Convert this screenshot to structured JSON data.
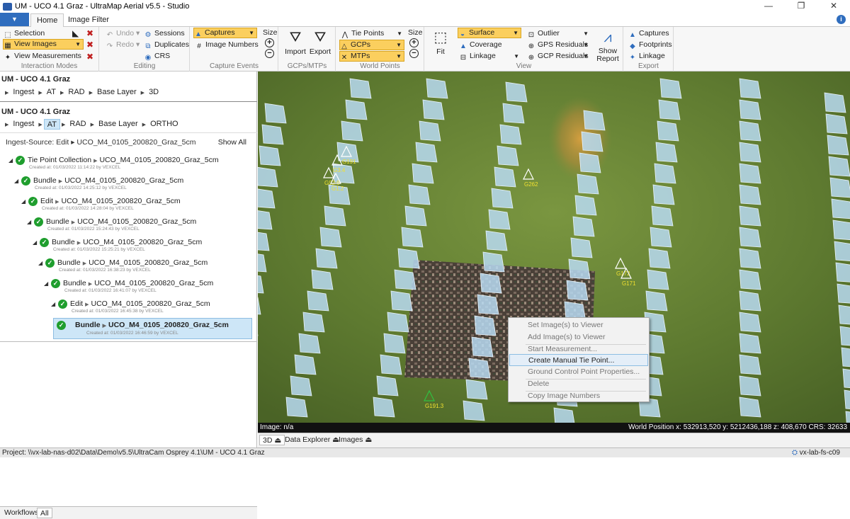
{
  "window": {
    "title": "UM - UCO 4.1 Graz - UltraMap Aerial v5.5 - Studio",
    "controls": [
      "—",
      "❐",
      "✕"
    ]
  },
  "ribbon_tabs": [
    "Home",
    "Image Filter"
  ],
  "ribbon": {
    "interaction": {
      "label": "Interaction Modes",
      "selection": "Selection",
      "view_images": "View Images",
      "view_measurements": "View Measurements"
    },
    "editing": {
      "label": "Editing",
      "undo": "Undo",
      "redo": "Redo",
      "sessions": "Sessions",
      "duplicates": "Duplicates",
      "crs": "CRS"
    },
    "capture": {
      "label": "Capture Events",
      "captures": "Captures",
      "image_numbers": "Image Numbers",
      "size": "Size"
    },
    "gcps": {
      "label": "GCPs/MTPs",
      "import": "Import",
      "export": "Export"
    },
    "world": {
      "label": "World Points",
      "tie_points": "Tie Points",
      "gcps": "GCPs",
      "mtps": "MTPs",
      "size": "Size"
    },
    "view": {
      "label": "View",
      "fit": "Fit",
      "surface": "Surface",
      "coverage": "Coverage",
      "linkage": "Linkage",
      "outlier": "Outlier",
      "gps_residuals": "GPS Residuals",
      "gcp_residuals": "GCP Residuals",
      "show_report_1": "Show",
      "show_report_2": "Report"
    },
    "export": {
      "label": "Export",
      "captures": "Captures",
      "footprints": "Footprints",
      "linkage": "Linkage"
    }
  },
  "workflow_3d": {
    "project": "UM - UCO 4.1 Graz",
    "steps": [
      "Ingest",
      "AT",
      "RAD",
      "Base Layer",
      "3D"
    ]
  },
  "workflow_ortho": {
    "project": "UM - UCO 4.1 Graz",
    "steps": [
      "Ingest",
      "AT",
      "RAD",
      "Base Layer",
      "ORTHO"
    ]
  },
  "ingest_source": "Ingest-Source:  Edit ▸ UCO_M4_0105_200820_Graz_5cm",
  "show_all": "Show All",
  "tree": [
    {
      "type": "Tie Point Collection",
      "name": "UCO_M4_0105_200820_Graz_5cm",
      "meta": "Created at: 01/03/2022 11:14:22 by VEXCEL"
    },
    {
      "type": "Bundle",
      "name": "UCO_M4_0105_200820_Graz_5cm",
      "meta": "Created at: 01/03/2022 14:25:12 by VEXCEL"
    },
    {
      "type": "Edit",
      "name": "UCO_M4_0105_200820_Graz_5cm",
      "meta": "Created at: 01/03/2022 14:28:04 by VEXCEL"
    },
    {
      "type": "Bundle",
      "name": "UCO_M4_0105_200820_Graz_5cm",
      "meta": "Created at: 01/03/2022 15:24:43 by VEXCEL"
    },
    {
      "type": "Bundle",
      "name": "UCO_M4_0105_200820_Graz_5cm",
      "meta": "Created at: 01/03/2022 15:25:21 by VEXCEL"
    },
    {
      "type": "Bundle",
      "name": "UCO_M4_0105_200820_Graz_5cm",
      "meta": "Created at: 01/03/2022 16:38:23 by VEXCEL"
    },
    {
      "type": "Bundle",
      "name": "UCO_M4_0105_200820_Graz_5cm",
      "meta": "Created at: 01/03/2022 16:41:07 by VEXCEL"
    },
    {
      "type": "Edit",
      "name": "UCO_M4_0105_200820_Graz_5cm",
      "meta": "Created at: 01/03/2022 16:45:38 by VEXCEL"
    },
    {
      "type": "Bundle",
      "name": "UCO_M4_0105_200820_Graz_5cm",
      "meta": "Created at: 01/03/2022 16:46:59 by VEXCEL"
    }
  ],
  "left_tabs": [
    "Workflows",
    "All"
  ],
  "viewer": {
    "gcp_labels": [
      "G191",
      "G3.4",
      "G92.9",
      "G1.2",
      "G262",
      "G172",
      "G171",
      "G191.3"
    ],
    "context_menu": [
      "Set Image(s) to Viewer",
      "Add Image(s) to Viewer",
      "Start Measurement...",
      "Create Manual Tie Point...",
      "Ground Control Point Properties...",
      "Delete",
      "Copy Image Numbers"
    ],
    "image_status": "Image: n/a",
    "world_position": "World Position  x: 532913,520  y: 5212436,188  z: 408,670  CRS: 32633"
  },
  "view_tabs": [
    "3D",
    "Data Explorer",
    "Images"
  ],
  "statusbar": {
    "project": "Project: \\\\vx-lab-nas-d02\\Data\\Demo\\v5.5\\UltraCam Osprey 4.1\\UM - UCO 4.1 Graz",
    "host": "vx-lab-fs-c09"
  },
  "colors": {
    "accent": "#2f6dbe",
    "ribbon_selected": "#fbcf5e",
    "gcp_yellow": "#f0e030",
    "footprint": "#b9daf2",
    "terrain": "#5d7a2e"
  }
}
